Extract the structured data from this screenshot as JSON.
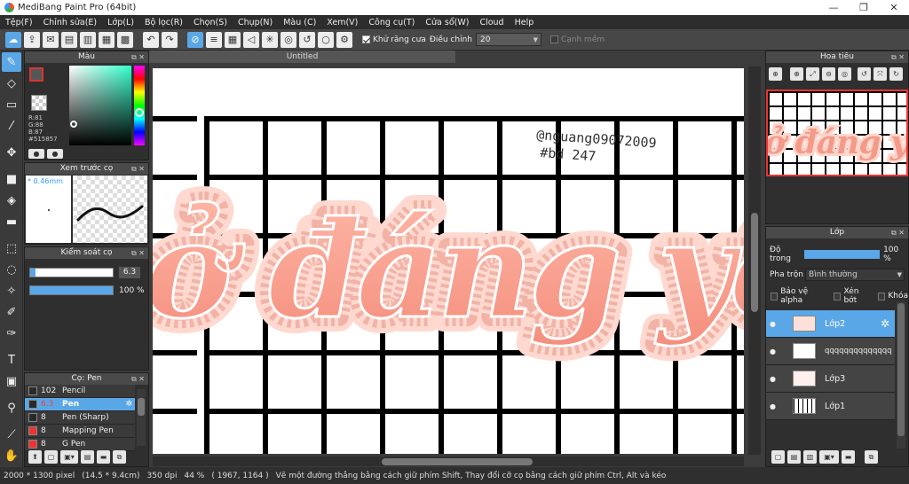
{
  "window": {
    "title": "MediBang Paint Pro (64bit)",
    "minimize": "—",
    "maximize": "❐",
    "close": "✕"
  },
  "menu": [
    "Tệp(F)",
    "Chỉnh sửa(E)",
    "Lớp(L)",
    "Bộ lọc(R)",
    "Chọn(S)",
    "Chụp(N)",
    "Màu (C)",
    "Xem(V)",
    "Công cụ(T)",
    "Cửa sổ(W)",
    "Cloud",
    "Help"
  ],
  "toolbar": {
    "antialias_label": "Khử răng cưa",
    "antialias_checked": true,
    "correction_label": "Điều chỉnh",
    "correction_value": "20",
    "snap_label": "Cạnh mềm",
    "snap_checked": false
  },
  "color_panel": {
    "title": "Màu",
    "r": "R:81",
    "g": "G:88",
    "b": "B:87",
    "hex": "#515857",
    "fg_color": "#515857",
    "fg_swatch_border": "#d33"
  },
  "brush_preview": {
    "title": "Xem trước cọ",
    "size_text": "* 0.46mm"
  },
  "brush_control": {
    "title": "Kiểm soát cọ",
    "size": "6.3",
    "size_fraction": 0.63,
    "opacity": "100 %",
    "opacity_fraction": 1.0
  },
  "brush_list": {
    "title": "Cọ: Pen",
    "items": [
      {
        "size": "102",
        "name": "Pencil",
        "color": "#2a2a2a",
        "selected": false
      },
      {
        "size": "6.3",
        "name": "Pen",
        "color": "#2a2a2a",
        "selected": true
      },
      {
        "size": "8",
        "name": "Pen (Sharp)",
        "color": "#2a2a2a",
        "selected": false
      },
      {
        "size": "8",
        "name": "Mapping Pen",
        "color": "#e33",
        "selected": false
      },
      {
        "size": "8",
        "name": "G Pen",
        "color": "#e33",
        "selected": false
      }
    ]
  },
  "document": {
    "tab_title": "Untitled"
  },
  "canvas_art": {
    "watermark_line1": "@nguang09072009",
    "watermark_line2": "#bd 247",
    "main_text": "ở đáng yêu"
  },
  "navigator": {
    "title": "Hoa tiêu"
  },
  "layer_panel": {
    "title": "Lớp",
    "opacity_label": "Độ trong",
    "opacity_value": "100 %",
    "opacity_fraction": 1.0,
    "blend_label": "Pha trộn",
    "blend_value": "Bình thường",
    "protect_alpha": "Bảo vệ alpha",
    "clipping": "Xén bớt",
    "lock": "Khóa",
    "layers": [
      {
        "name": "Lớp2",
        "selected": true
      },
      {
        "name": "qqqqqqqqqqqqqq",
        "selected": false
      },
      {
        "name": "Lớp3",
        "selected": false
      },
      {
        "name": "Lớp1",
        "selected": false
      }
    ]
  },
  "status": {
    "pixels": "2000 * 1300 pixel",
    "cm": "(14.5 * 9.4cm)",
    "dpi": "350 dpi",
    "zoom": "44 %",
    "coords": "( 1967, 1164 )",
    "hint": "Vẽ một đường thẳng bằng cách giữ phím Shift, Thay đổi cỡ cọ bằng cách giữ phím Ctrl, Alt và kéo"
  }
}
